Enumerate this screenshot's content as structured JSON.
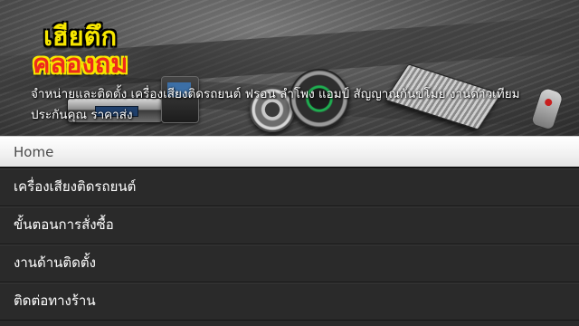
{
  "header": {
    "logo_line1": "เฮียตึก",
    "logo_line2": "คลองถม",
    "tagline": "จำหน่ายและติดตั้ง เครื่องเสียงติดรถยนต์ ฟรอน ลำโพง แอมป์ สัญญาณกันขโมย งานดาวเทียม ประกันคุณ ราคาส่ง"
  },
  "menu": {
    "items": [
      {
        "label": "Home",
        "active": true
      },
      {
        "label": "เครื่องเสียงติดรถยนต์"
      },
      {
        "label": "ขั้นตอนการสั่งซื้อ"
      },
      {
        "label": "งานด้านติดตั้ง"
      },
      {
        "label": "ติดต่อทางร้าน"
      }
    ]
  },
  "colors": {
    "logo_yellow": "#f6e600",
    "logo_red": "#ee2a1c",
    "menu_bg": "#2a2a2a",
    "menu_active_bg": "#ffffff"
  }
}
